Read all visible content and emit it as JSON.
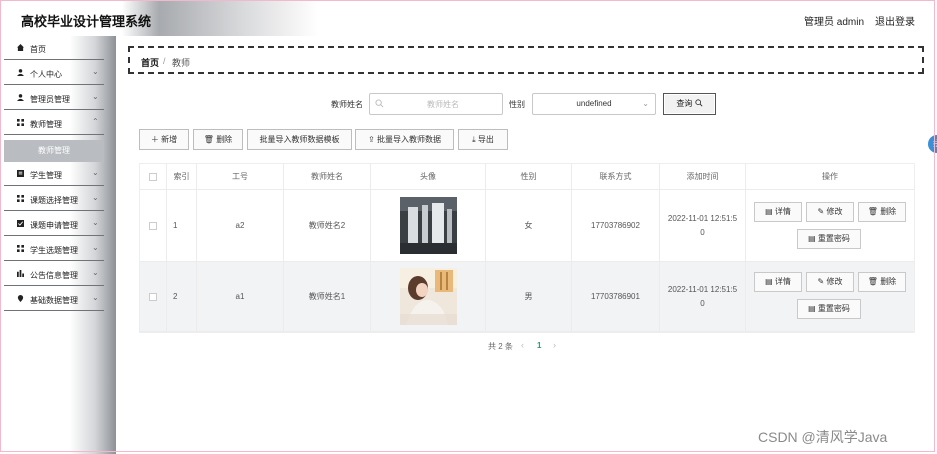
{
  "header": {
    "title": "高校毕业设计管理系统",
    "admin": "管理员 admin",
    "logout": "退出登录"
  },
  "sidebar": {
    "items": [
      {
        "label": "首页",
        "icon": "home-icon"
      },
      {
        "label": "个人中心",
        "icon": "user-icon"
      },
      {
        "label": "管理员管理",
        "icon": "user-icon"
      },
      {
        "label": "教师管理",
        "icon": "grid-icon"
      },
      {
        "label": "学生管理",
        "icon": "doc-icon"
      },
      {
        "label": "课题选择管理",
        "icon": "grid-icon"
      },
      {
        "label": "课题申请管理",
        "icon": "check-icon"
      },
      {
        "label": "学生选题管理",
        "icon": "grid-icon"
      },
      {
        "label": "公告信息管理",
        "icon": "chart-icon"
      },
      {
        "label": "基础数据管理",
        "icon": "pin-icon"
      }
    ],
    "active_sub": "教师管理"
  },
  "breadcrumb": {
    "home": "首页",
    "sep": "/",
    "current": "教师"
  },
  "search": {
    "name_label": "教师姓名",
    "name_placeholder": "教师姓名",
    "gender_label": "性别",
    "gender_value": "undefined",
    "query_button": "查询"
  },
  "toolbar": {
    "add": "新增",
    "delete": "删除",
    "import_template": "批量导入教师数据模板",
    "import_data": "批量导入教师数据",
    "export": "导出"
  },
  "table": {
    "columns": [
      "索引",
      "工号",
      "教师姓名",
      "头像",
      "性别",
      "联系方式",
      "添加时间",
      "操作"
    ],
    "rows": [
      {
        "index": "1",
        "id": "a2",
        "name": "教师姓名2",
        "gender": "女",
        "phone": "17703786902",
        "time_line1": "2022-11-01 12:51:5",
        "time_line2": "0"
      },
      {
        "index": "2",
        "id": "a1",
        "name": "教师姓名1",
        "gender": "男",
        "phone": "17703786901",
        "time_line1": "2022-11-01 12:51:5",
        "time_line2": "0"
      }
    ],
    "actions": {
      "detail": "详情",
      "edit": "修改",
      "delete": "删除",
      "reset": "重置密码"
    }
  },
  "pagination": {
    "total": "共 2 条",
    "current": "1",
    "prev": "‹",
    "next": "›"
  },
  "watermark": "CSDN @清风学Java",
  "edge_badge": "拼"
}
